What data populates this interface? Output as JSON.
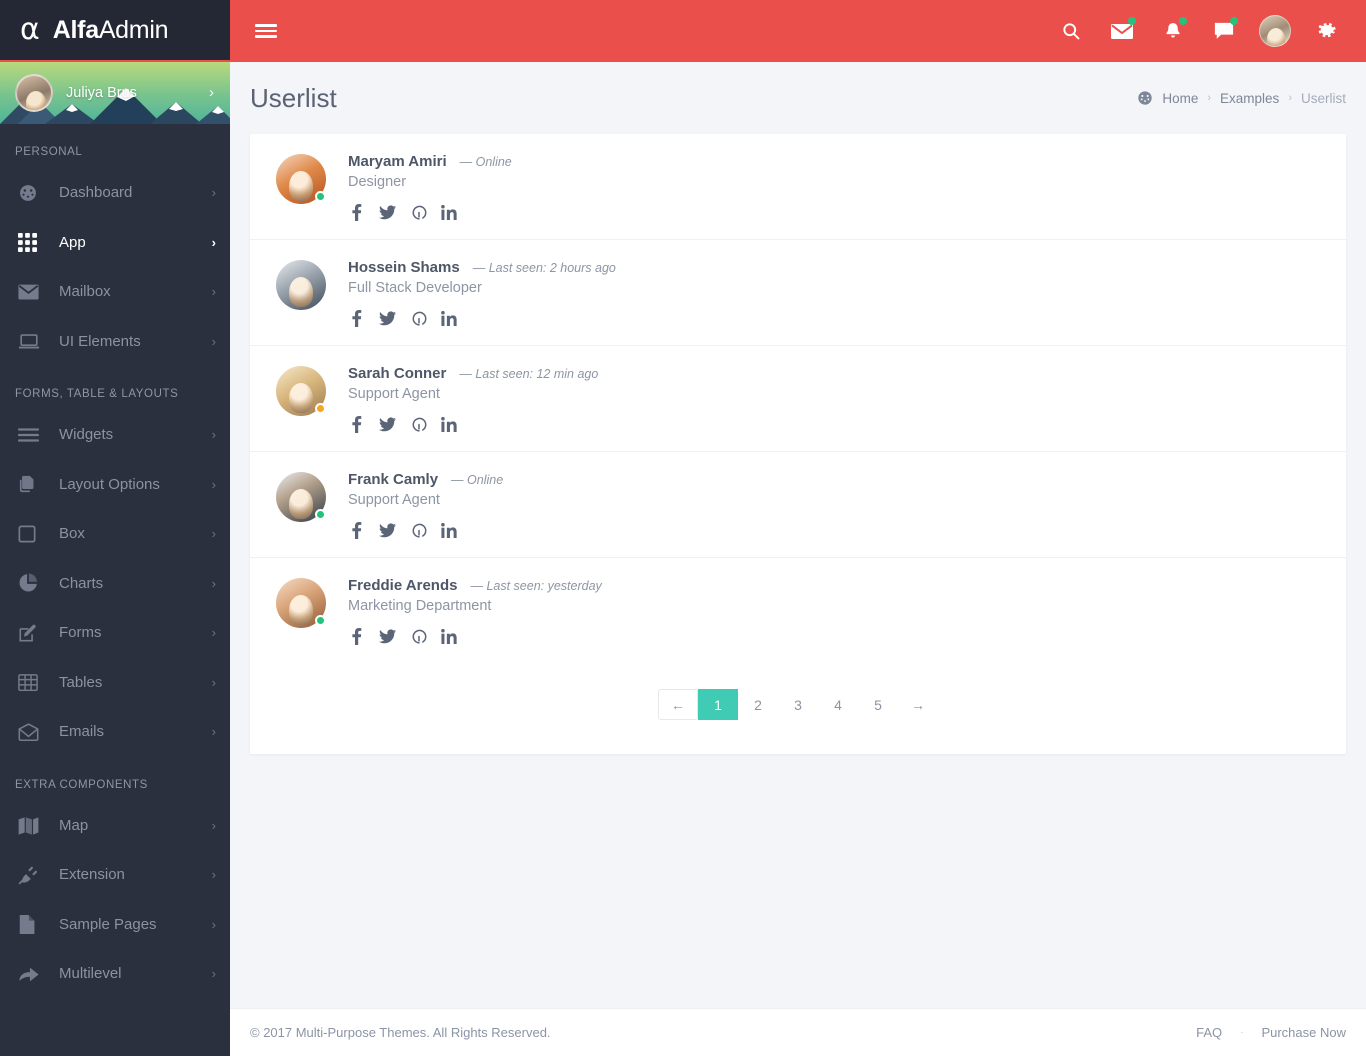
{
  "brand": {
    "alpha_glyph": "α",
    "name_bold": "Alfa",
    "name_light": "Admin"
  },
  "colors": {
    "header_red": "#eb4f4b",
    "sidebar_dark": "#2a303d",
    "page_bg": "#f4f5f9",
    "accent_teal": "#40cbb4",
    "status_online": "#27c17c",
    "status_away": "#f5a623",
    "notification_dot": "#27c17c"
  },
  "profile": {
    "name": "Juliya Brus",
    "chevron": "›",
    "avatar_name": "profile-avatar"
  },
  "sidebar": {
    "sections": [
      {
        "label": "PERSONAL",
        "items": [
          {
            "label": "Dashboard",
            "icon": "gauge-icon",
            "caret": "›",
            "active": false
          },
          {
            "label": "App",
            "icon": "grid-icon",
            "caret": "›",
            "active": true
          },
          {
            "label": "Mailbox",
            "icon": "envelope-icon",
            "caret": "›",
            "active": false
          },
          {
            "label": "UI Elements",
            "icon": "laptop-icon",
            "caret": "›",
            "active": false
          }
        ]
      },
      {
        "label": "FORMS, TABLE & LAYOUTS",
        "items": [
          {
            "label": "Widgets",
            "icon": "list-lines-icon",
            "caret": "›",
            "active": false
          },
          {
            "label": "Layout Options",
            "icon": "copy-pages-icon",
            "caret": "›",
            "active": false
          },
          {
            "label": "Box",
            "icon": "square-icon",
            "caret": "›",
            "active": false
          },
          {
            "label": "Charts",
            "icon": "pie-chart-icon",
            "caret": "›",
            "active": false
          },
          {
            "label": "Forms",
            "icon": "edit-pencil-icon",
            "caret": "›",
            "active": false
          },
          {
            "label": "Tables",
            "icon": "table-grid-icon",
            "caret": "›",
            "active": false
          },
          {
            "label": "Emails",
            "icon": "open-envelope-icon",
            "caret": "›",
            "active": false
          }
        ]
      },
      {
        "label": "EXTRA COMPONENTS",
        "items": [
          {
            "label": "Map",
            "icon": "map-icon",
            "caret": "›",
            "active": false
          },
          {
            "label": "Extension",
            "icon": "plug-icon",
            "caret": "›",
            "active": false
          },
          {
            "label": "Sample Pages",
            "icon": "file-icon",
            "caret": "›",
            "active": false
          },
          {
            "label": "Multilevel",
            "icon": "arrow-share-icon",
            "caret": "›",
            "active": false
          }
        ]
      }
    ]
  },
  "topbar": {
    "menu_toggle": "hamburger-icon",
    "actions": [
      {
        "icon": "search-icon",
        "has_dot": false
      },
      {
        "icon": "mail-icon",
        "has_dot": true
      },
      {
        "icon": "bell-icon",
        "has_dot": true
      },
      {
        "icon": "chat-icon",
        "has_dot": true
      }
    ],
    "avatar": "user-avatar",
    "settings_icon": "gear-icon"
  },
  "page": {
    "title": "Userlist",
    "breadcrumb": {
      "home_icon": "dashboard-icon",
      "items": [
        "Home",
        "Examples",
        "Userlist"
      ],
      "separator": "›"
    }
  },
  "users": [
    {
      "name": "Maryam Amiri",
      "seen": "— Online",
      "role": "Designer",
      "status": "online",
      "avatar_tone": "linear-gradient(150deg,#f4d8c4 0%,#e08a4a 45%,#b4501f 100%)",
      "social": [
        "facebook-icon",
        "twitter-icon",
        "github-icon",
        "linkedin-icon"
      ]
    },
    {
      "name": "Hossein Shams",
      "seen": "— Last seen: 2 hours ago",
      "role": "Full Stack Developer",
      "status": "none",
      "avatar_tone": "linear-gradient(150deg,#e9ecef 0%,#9aa3ad 45%,#3d4a57 100%)",
      "social": [
        "facebook-icon",
        "twitter-icon",
        "github-icon",
        "linkedin-icon"
      ]
    },
    {
      "name": "Sarah Conner",
      "seen": "— Last seen: 12 min ago",
      "role": "Support Agent",
      "status": "away",
      "avatar_tone": "linear-gradient(150deg,#f7e9cf 0%,#d9b77e 45%,#9a7b4e 100%)",
      "social": [
        "facebook-icon",
        "twitter-icon",
        "github-icon",
        "linkedin-icon"
      ]
    },
    {
      "name": "Frank Camly",
      "seen": "— Online",
      "role": "Support Agent",
      "status": "online",
      "avatar_tone": "linear-gradient(150deg,#eceff2 0%,#b4a08c 40%,#2f3a46 100%)",
      "social": [
        "facebook-icon",
        "twitter-icon",
        "github-icon",
        "linkedin-icon"
      ]
    },
    {
      "name": "Freddie Arends",
      "seen": "— Last seen: yesterday",
      "role": "Marketing Department",
      "status": "online",
      "avatar_tone": "linear-gradient(150deg,#f6ddc6 0%,#d8a277 45%,#8d5a37 100%)",
      "social": [
        "facebook-icon",
        "twitter-icon",
        "github-icon",
        "linkedin-icon"
      ]
    }
  ],
  "pagination": {
    "prev": "←",
    "next": "→",
    "pages": [
      "1",
      "2",
      "3",
      "4",
      "5"
    ],
    "active": "1"
  },
  "footer": {
    "copyright": "© 2017 Multi-Purpose Themes. All Rights Reserved.",
    "faq": "FAQ",
    "separator": "·",
    "purchase": "Purchase Now"
  }
}
